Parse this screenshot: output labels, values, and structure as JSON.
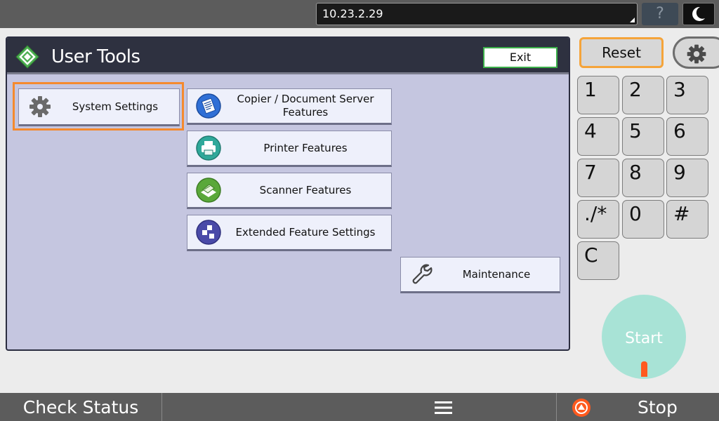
{
  "topbar": {
    "address": "10.23.2.29",
    "help_label": "?"
  },
  "panel": {
    "title": "User Tools",
    "exit_label": "Exit",
    "tools": {
      "system_settings": "System Settings",
      "copier_line1": "Copier / Document Server",
      "copier_line2": "Features",
      "printer": "Printer Features",
      "scanner": "Scanner Features",
      "extended": "Extended Feature Settings",
      "maintenance": "Maintenance"
    }
  },
  "side": {
    "reset_label": "Reset",
    "keys": [
      "1",
      "2",
      "3",
      "4",
      "5",
      "6",
      "7",
      "8",
      "9",
      "./*",
      "0",
      "#",
      "C"
    ],
    "start_label": "Start"
  },
  "bottombar": {
    "check_status": "Check Status",
    "stop": "Stop"
  },
  "colors": {
    "highlight": "#f58a2e",
    "exit_border": "#3cb04a",
    "start": "#a8e3d6",
    "stop_icon": "#ff5a1f"
  },
  "icons": [
    "moon-icon",
    "logo-icon",
    "gear-icon",
    "copier-icon",
    "printer-icon",
    "scanner-icon",
    "extended-icon",
    "wrench-icon",
    "menu-icon",
    "stop-icon"
  ]
}
